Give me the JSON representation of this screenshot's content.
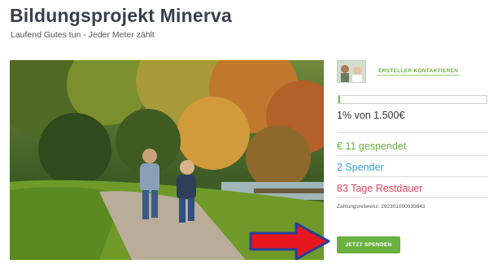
{
  "header": {
    "title": "Bildungsprojekt Minerva",
    "subtitle": "Laufend Gutes tun - Jeder Meter zählt"
  },
  "creator": {
    "contact_label": "ERSTELLER KONTAKTIEREN"
  },
  "progress": {
    "percent": 1,
    "funded_text": "1% von  1.500€"
  },
  "stats": {
    "donated": "€ 11  gespendet",
    "donors": "2 Spender",
    "remaining": "83 Tage Restdauer"
  },
  "payment_reference": "Zahlungsreferenz: 292301000035643",
  "donate_button": "JETZT SPENDEN",
  "colors": {
    "accent_green": "#6ab23f",
    "donors_blue": "#3a9fd6",
    "remaining_red": "#e0455f",
    "arrow_red": "#e8171f"
  }
}
